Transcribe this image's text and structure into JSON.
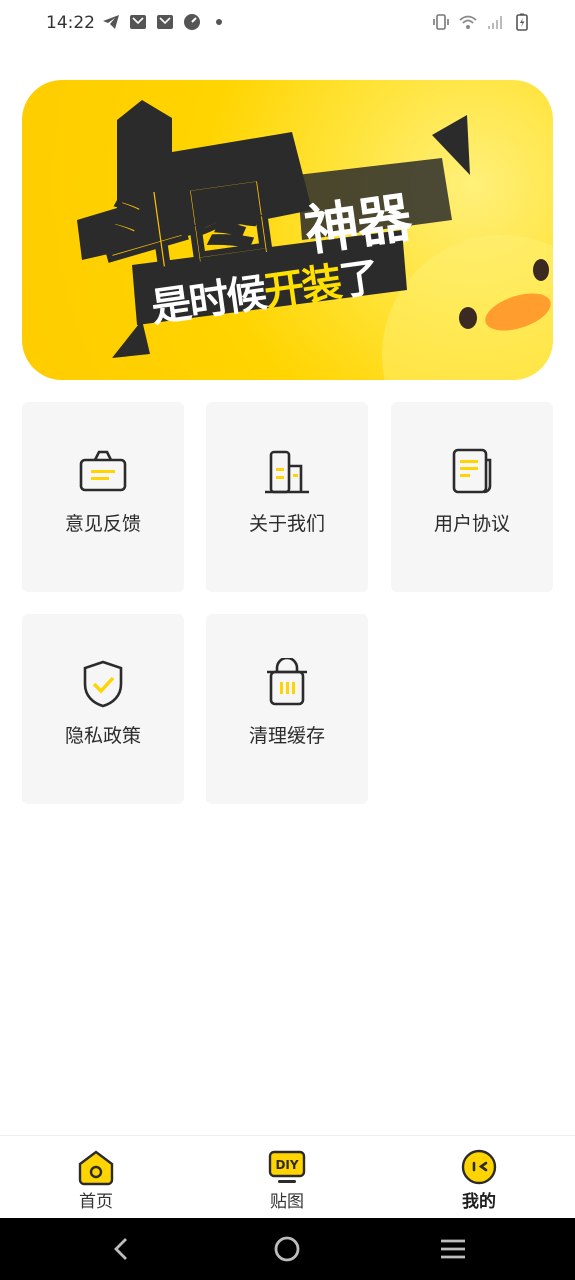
{
  "status_bar": {
    "time": "14:22",
    "left_icons": [
      "telegram-icon",
      "mail-icon",
      "mail-icon",
      "speed-icon",
      "dot-icon"
    ],
    "right_icons": [
      "vibrate-icon",
      "wifi-icon",
      "signal-icon",
      "battery-icon"
    ]
  },
  "banner": {
    "title_main": "斗图",
    "title_side": "神器",
    "slogan_part1": "是时候",
    "slogan_highlight": "开装",
    "slogan_part2": "了"
  },
  "menu": {
    "items": [
      {
        "label": "意见反馈",
        "icon": "feedback-icon"
      },
      {
        "label": "关于我们",
        "icon": "building-icon"
      },
      {
        "label": "用户协议",
        "icon": "document-icon"
      },
      {
        "label": "隐私政策",
        "icon": "shield-check-icon"
      },
      {
        "label": "清理缓存",
        "icon": "trash-icon"
      }
    ]
  },
  "tabbar": {
    "tabs": [
      {
        "label": "首页",
        "icon": "home-icon",
        "active": false
      },
      {
        "label": "贴图",
        "icon": "diy-icon",
        "active": false,
        "icon_text": "DIY"
      },
      {
        "label": "我的",
        "icon": "face-icon",
        "active": true
      }
    ]
  },
  "colors": {
    "accent": "#FFD400",
    "accent_dark": "#2B2B2B",
    "card_bg": "#F6F6F6"
  }
}
